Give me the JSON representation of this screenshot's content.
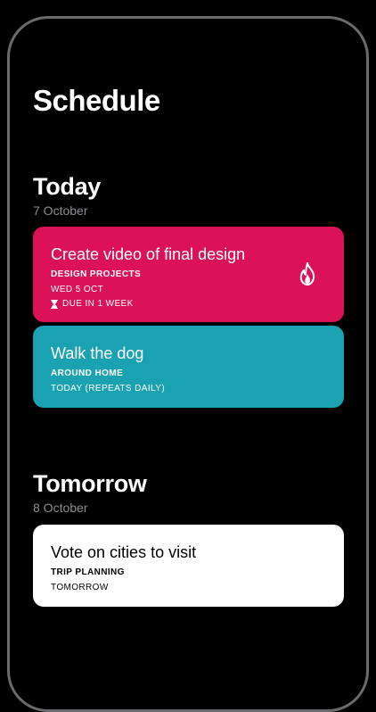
{
  "page": {
    "title": "Schedule"
  },
  "colors": {
    "background": "#000000",
    "card_urgent": "#dc1258",
    "card_routine": "#1aa2b2",
    "card_light": "#ffffff",
    "muted_text": "#8e8e93"
  },
  "sections": [
    {
      "title": "Today",
      "date": "7 October",
      "tasks": [
        {
          "title": "Create video of final design",
          "category": "DESIGN PROJECTS",
          "date": "WED 5 OCT",
          "due": "DUE IN 1 WEEK",
          "icon": "fire-icon",
          "color": "#dc1258"
        },
        {
          "title": "Walk the dog",
          "category": "AROUND HOME",
          "date": "TODAY (REPEATS DAILY)",
          "color": "#1aa2b2"
        }
      ]
    },
    {
      "title": "Tomorrow",
      "date": "8 October",
      "tasks": [
        {
          "title": "Vote on cities to visit",
          "category": "TRIP PLANNING",
          "date": "TOMORROW",
          "color": "#ffffff"
        }
      ]
    }
  ]
}
